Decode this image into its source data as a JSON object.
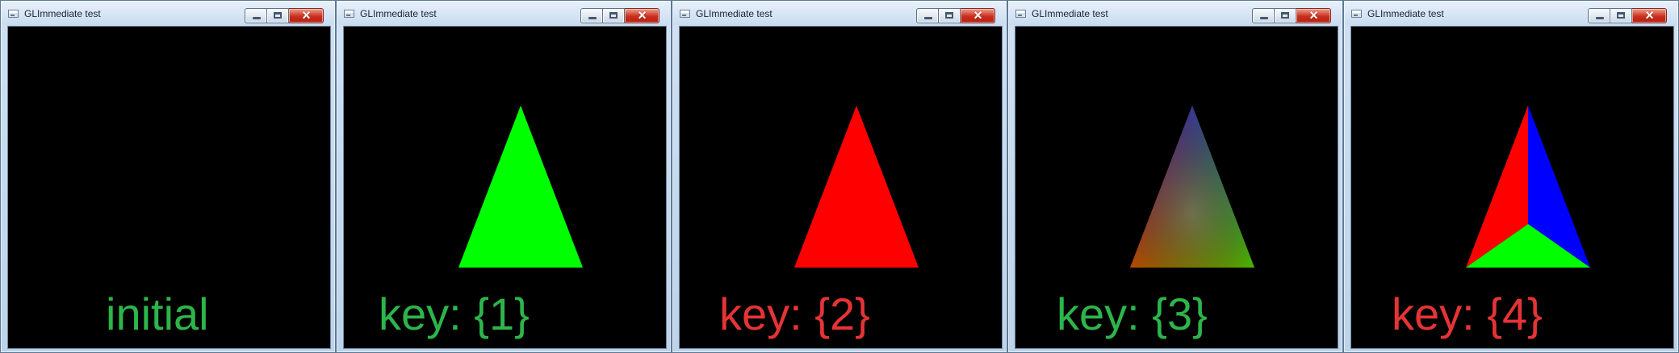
{
  "screen": {
    "background": "#c9dbee"
  },
  "windows": [
    {
      "title": "GLImmediate test",
      "label": "initial",
      "label_color": "#2db54b",
      "mode": "empty",
      "icon": "application-window-icon",
      "caption_buttons": {
        "minimize": "minimize-icon",
        "maximize": "maximize-icon",
        "close_icon": "close-icon",
        "close_text": "×"
      }
    },
    {
      "title": "GLImmediate test",
      "label": "key: {1}",
      "label_color": "#2db54b",
      "mode": "solid",
      "fill": "#00ff00",
      "icon": "application-window-icon",
      "caption_buttons": {
        "minimize": "minimize-icon",
        "maximize": "maximize-icon",
        "close_icon": "close-icon",
        "close_text": "×"
      }
    },
    {
      "title": "GLImmediate test",
      "label": "key: {2}",
      "label_color": "#e53436",
      "mode": "solid",
      "fill": "#ff0000",
      "icon": "application-window-icon",
      "caption_buttons": {
        "minimize": "minimize-icon",
        "maximize": "maximize-icon",
        "close_icon": "close-icon",
        "close_text": "×"
      }
    },
    {
      "title": "GLImmediate test",
      "label": "key: {3}",
      "label_color": "#2db54b",
      "mode": "gradient",
      "colors": [
        "#0000ff",
        "#ff0000",
        "#00ff00"
      ],
      "icon": "application-window-icon",
      "caption_buttons": {
        "minimize": "minimize-icon",
        "maximize": "maximize-icon",
        "close_icon": "close-icon",
        "close_text": "×"
      }
    },
    {
      "title": "GLImmediate test",
      "label": "key: {4}",
      "label_color": "#e53436",
      "mode": "sectioned",
      "colors": [
        "#ff0000",
        "#0000ff",
        "#00ff00"
      ],
      "icon": "application-window-icon",
      "caption_buttons": {
        "minimize": "minimize-icon",
        "maximize": "maximize-icon",
        "close_icon": "close-icon",
        "close_text": "×"
      }
    }
  ]
}
